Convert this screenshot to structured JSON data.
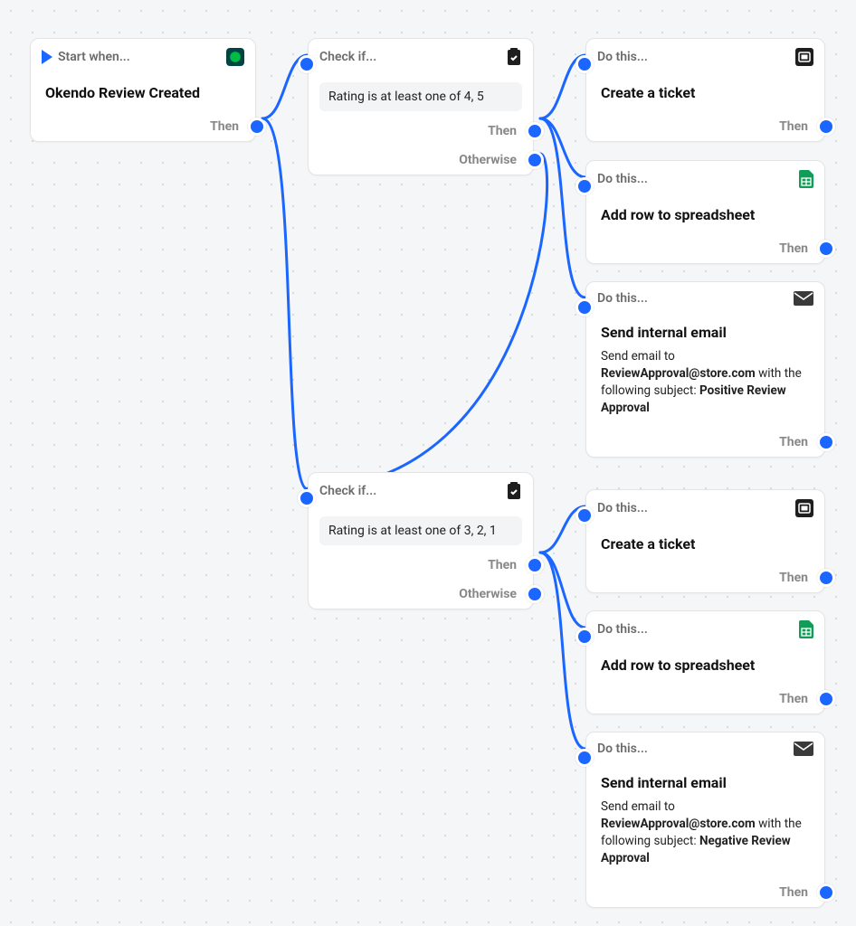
{
  "labels": {
    "then": "Then",
    "otherwise": "Otherwise",
    "start_when": "Start when...",
    "check_if": "Check if...",
    "do_this": "Do this..."
  },
  "trigger": {
    "title": "Okendo Review Created"
  },
  "check1": {
    "rule": "Rating is at least one of 4, 5"
  },
  "check2": {
    "rule": "Rating is at least one of 3, 2, 1"
  },
  "action_ticket": {
    "title": "Create a ticket"
  },
  "action_sheet": {
    "title": "Add row to spreadsheet"
  },
  "action_email_pos": {
    "title": "Send internal email",
    "desc_prefix": "Send email to ",
    "email": "ReviewApproval@store.com",
    "desc_mid": " with the following subject: ",
    "subject": "Positive Review Approval"
  },
  "action_email_neg": {
    "title": "Send internal email",
    "desc_prefix": "Send email to ",
    "email": "ReviewApproval@store.com",
    "desc_mid": " with the following subject: ",
    "subject": "Negative Review Approval"
  }
}
